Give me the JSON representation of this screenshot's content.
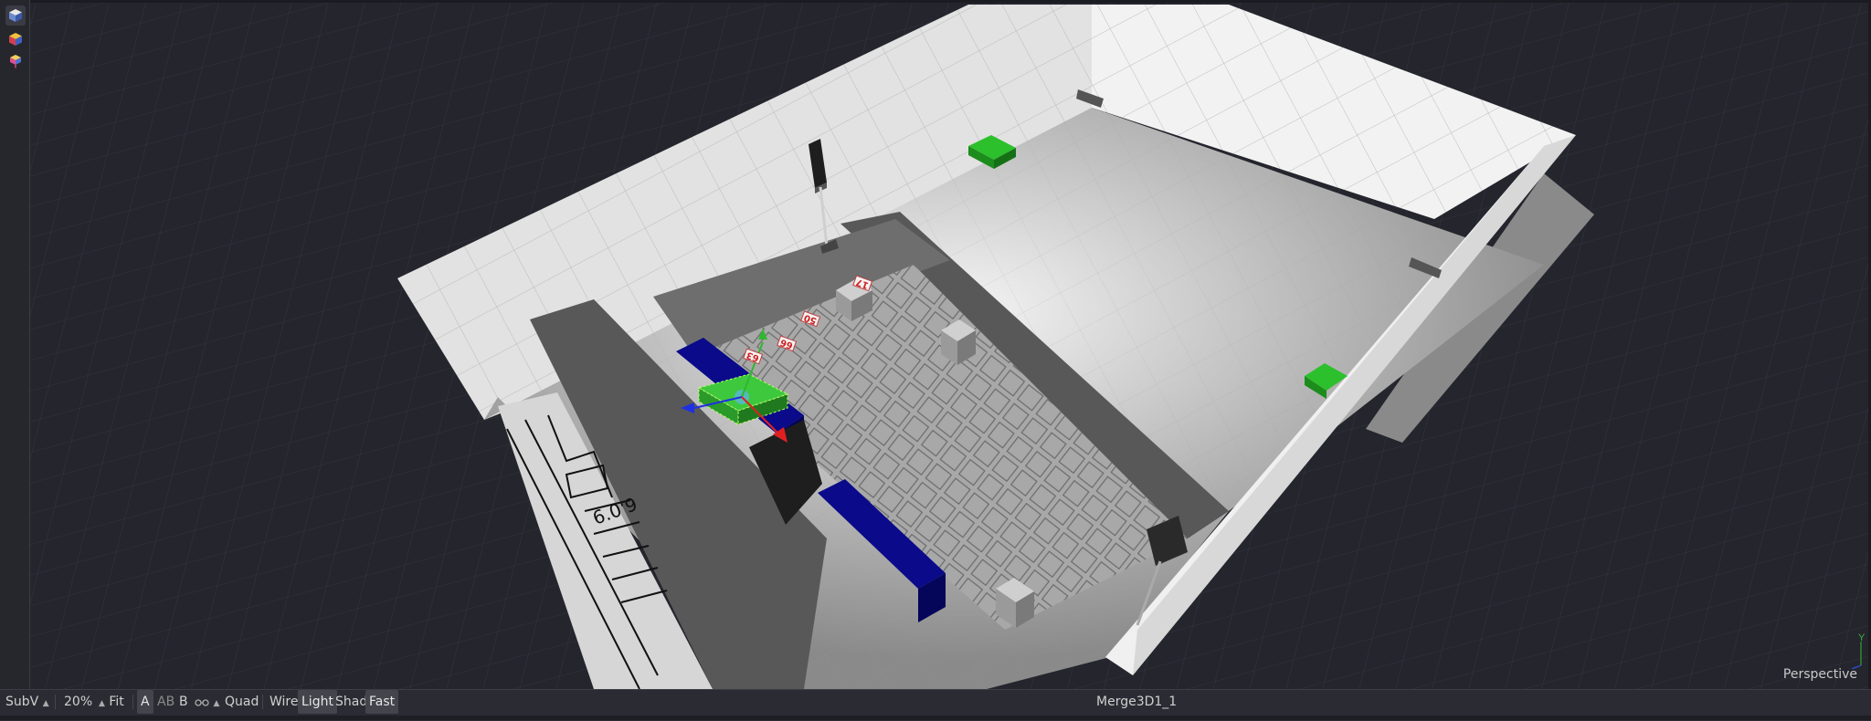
{
  "viewport": {
    "camera_label": "Perspective",
    "axis_y_label": "Y",
    "seat_labels": [
      "17",
      "50",
      "66",
      "63"
    ]
  },
  "bottom_bar": {
    "subview_label": "SubV",
    "zoom_label": "20%",
    "fit_label": "Fit",
    "a_label": "A",
    "ab_label": "AB",
    "b_label": "B",
    "quad_label": "Quad",
    "wire_label": "Wire",
    "light_label": "Light",
    "shad_label": "Shad",
    "fast_label": "Fast",
    "node_name": "Merge3D1_1",
    "dropdown_arrow": "▲"
  },
  "colors": {
    "grid_bg": "#24252d",
    "wall": "#d8d8d8",
    "floor": "#8c8c8c",
    "selection": "#2db82d",
    "blue_box": "#0d0d8f",
    "accent_red": "#d02020"
  },
  "icons": {
    "toolbar": [
      "cube-3d-icon",
      "cube-color-icon",
      "cube-pin-icon"
    ],
    "ab_icon": "stereo-icon"
  }
}
